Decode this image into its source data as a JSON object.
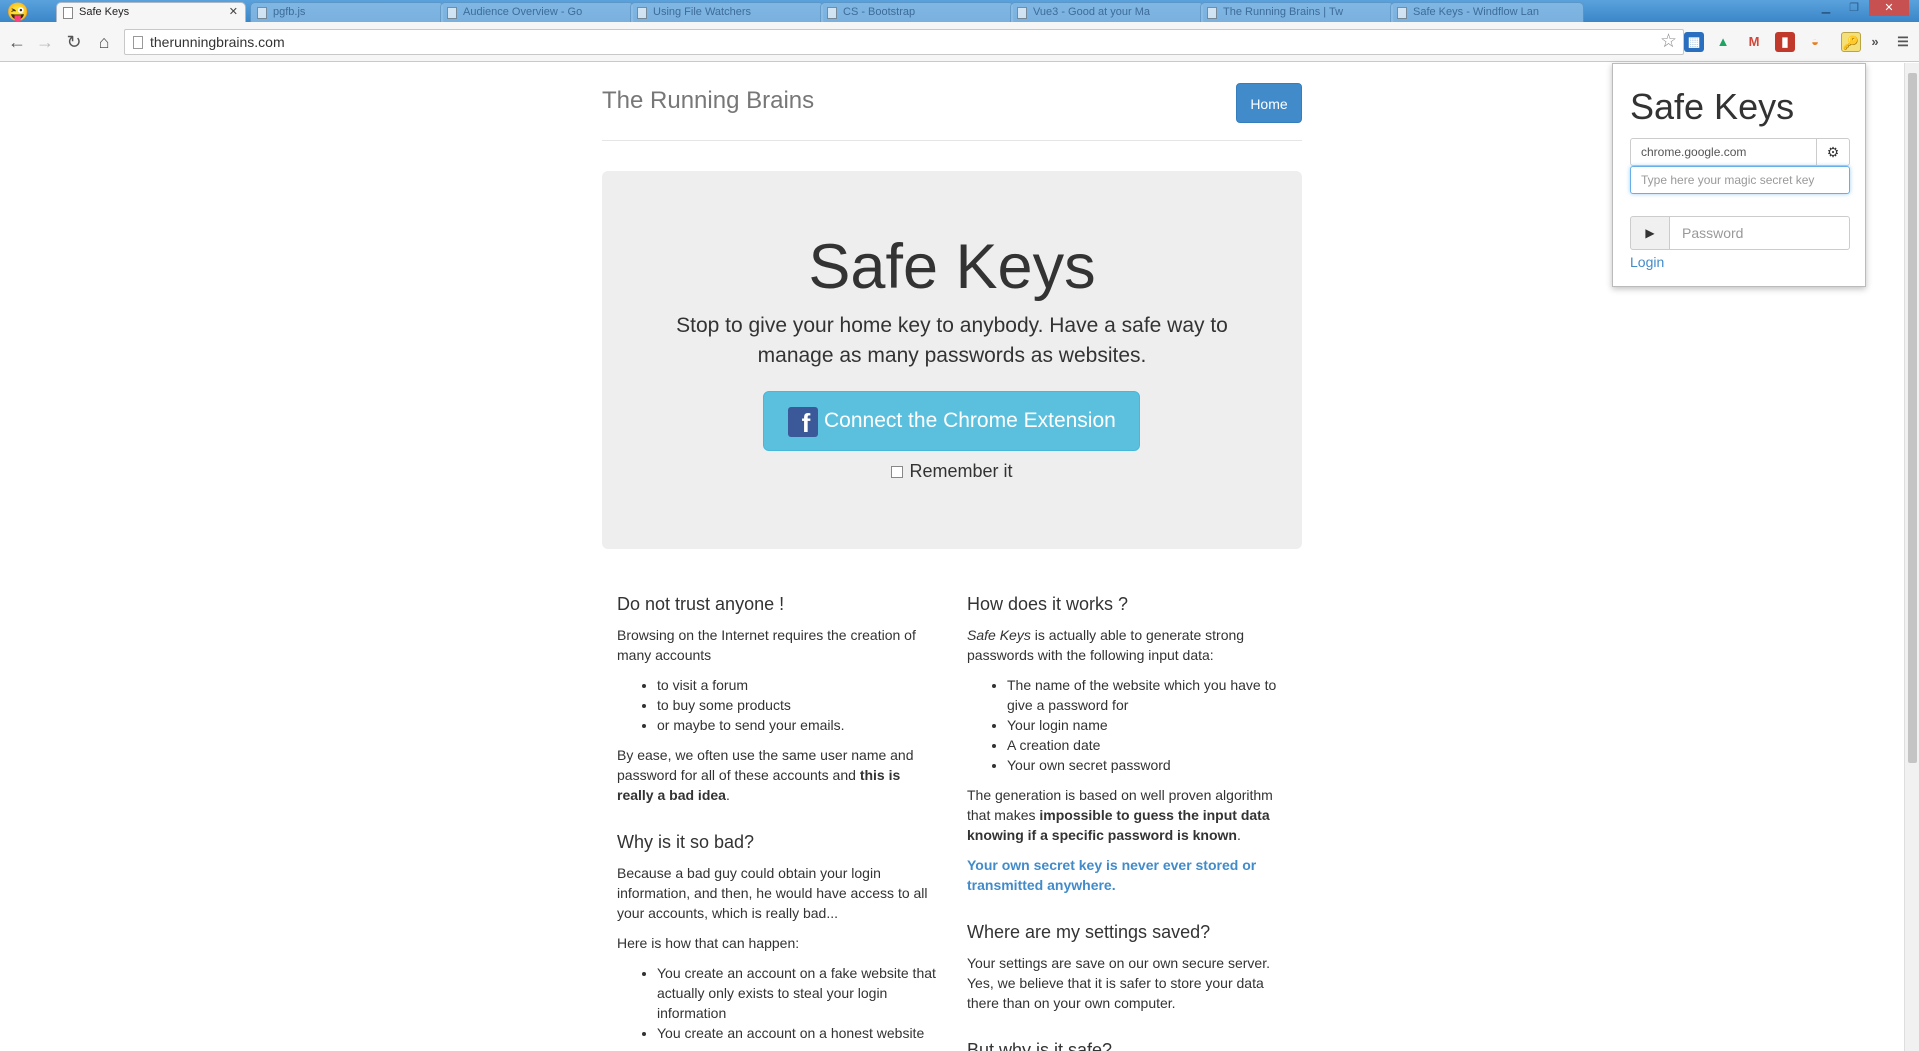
{
  "tabs": [
    {
      "title": "Safe Keys",
      "active": true
    },
    {
      "title": "pgfb.js",
      "active": false
    },
    {
      "title": "Audience Overview - Go",
      "active": false
    },
    {
      "title": "Using File Watchers",
      "active": false
    },
    {
      "title": "CS - Bootstrap",
      "active": false
    },
    {
      "title": "Vue3 - Good at your Ma",
      "active": false
    },
    {
      "title": "The Running Brains | Tw",
      "active": false
    },
    {
      "title": "Safe Keys - Windflow Lan",
      "active": false
    }
  ],
  "browser": {
    "url": "therunningbrains.com"
  },
  "site": {
    "brand": "The Running Brains",
    "home_label": "Home",
    "hero_title": "Safe Keys",
    "hero_lead": "Stop to give your home key to anybody. Have a safe way to manage as many passwords as websites.",
    "connect_label": "Connect the Chrome Extension",
    "remember_label": "Remember it"
  },
  "left_col": {
    "h1": "Do not trust anyone !",
    "p1": "Browsing on the Internet requires the creation of many accounts",
    "list1": [
      "to visit a forum",
      "to buy some products",
      "or maybe to send your emails."
    ],
    "p2_a": "By ease, we often use the same user name and password for all of these accounts and ",
    "p2_b": "this is really a bad idea",
    "p2_c": ".",
    "h2": "Why is it so bad?",
    "p3": "Because a bad guy could obtain your login information, and then, he would have access to all your accounts, which is really bad...",
    "p4": "Here is how that can happen:",
    "list2": [
      "You create an account on a fake website that actually only exists to steal your login information",
      "You create an account on a honest website"
    ]
  },
  "right_col": {
    "h1": "How does it works ?",
    "p1_a": "Safe Keys",
    "p1_b": " is actually able to generate strong passwords with the following input data:",
    "list1": [
      "The name of the website which you have to give a password for",
      "Your login name",
      "A creation date",
      "Your own secret password"
    ],
    "p2_a": "The generation is based on well proven algorithm that makes ",
    "p2_b": "impossible to guess the input data knowing if a specific password is known",
    "p2_c": ".",
    "p3": "Your own secret key is never ever stored or transmitted anywhere.",
    "h2": "Where are my settings saved?",
    "p4": "Your settings are save on our own secure server. Yes, we believe that it is safer to store your data there than on your own computer.",
    "h3": "But why is it safe?"
  },
  "popup": {
    "title": "Safe Keys",
    "site_value": "chrome.google.com",
    "secret_placeholder": "Type here your magic secret key",
    "password_placeholder": "Password",
    "login_label": "Login"
  },
  "colors": {
    "primary": "#428bca",
    "info": "#5bc0de",
    "facebook": "#3b5998"
  }
}
